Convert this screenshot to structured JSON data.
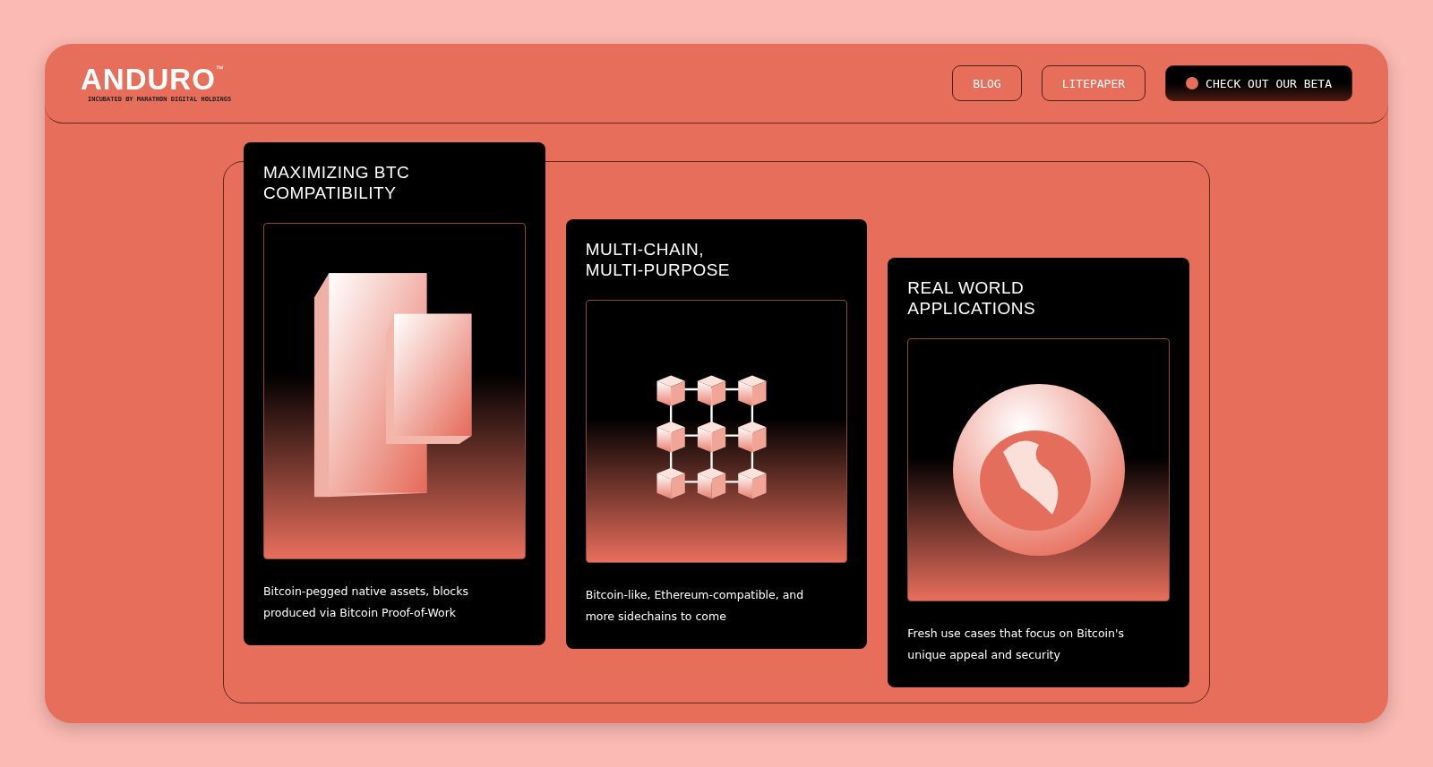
{
  "header": {
    "logo": "ANDURO",
    "trademark": "™",
    "tagline": "INCUBATED BY MARATHON DIGITAL HOLDINGS",
    "nav": [
      {
        "label": "BLOG",
        "kind": "outline"
      },
      {
        "label": "LITEPAPER",
        "kind": "outline"
      },
      {
        "label": "CHECK OUT OUR BETA",
        "kind": "primary"
      }
    ]
  },
  "cards": [
    {
      "title": "MAXIMIZING BTC\nCOMPATIBILITY",
      "kind": "blocks",
      "description": "Bitcoin-pegged native assets, blocks\nproduced via Bitcoin Proof-of-Work"
    },
    {
      "title": "MULTI-CHAIN,\nMULTI-PURPOSE",
      "kind": "cube-grid",
      "description": "Bitcoin-like, Ethereum-compatible, and\nmore sidechains to come"
    },
    {
      "title": "REAL WORLD\nAPPLICATIONS",
      "kind": "globe",
      "description": "Fresh use cases that focus on Bitcoin's\nunique appeal and security"
    }
  ]
}
